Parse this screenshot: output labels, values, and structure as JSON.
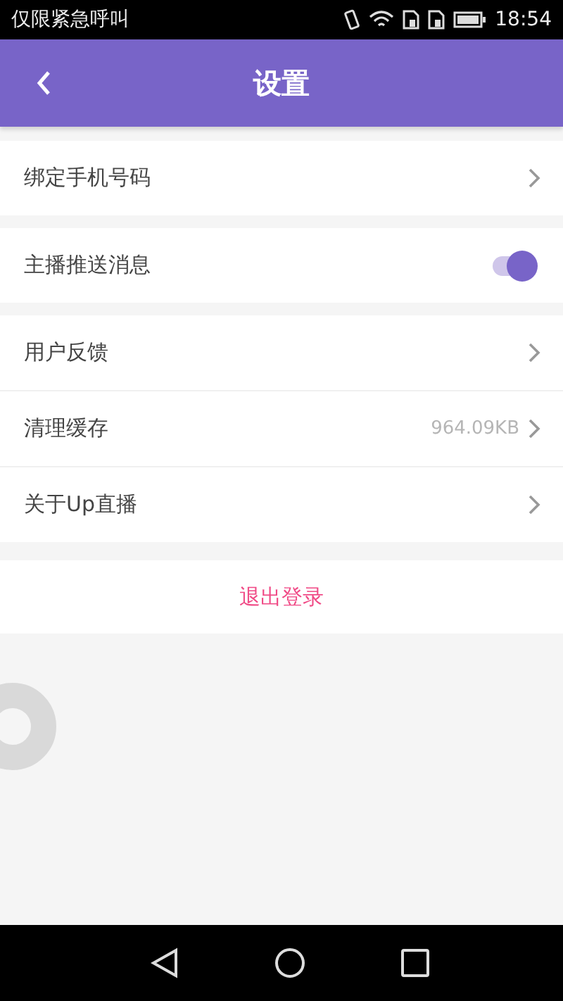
{
  "status_bar": {
    "notice": "仅限紧急呼叫",
    "time": "18:54"
  },
  "header": {
    "title": "设置"
  },
  "groups": [
    [
      {
        "kind": "link",
        "label": "绑定手机号码"
      }
    ],
    [
      {
        "kind": "toggle",
        "label": "主播推送消息",
        "on": true
      }
    ],
    [
      {
        "kind": "link",
        "label": "用户反馈"
      },
      {
        "kind": "value",
        "label": "清理缓存",
        "value": "964.09KB"
      },
      {
        "kind": "link",
        "label": "关于Up直播"
      }
    ]
  ],
  "logout": {
    "label": "退出登录"
  }
}
